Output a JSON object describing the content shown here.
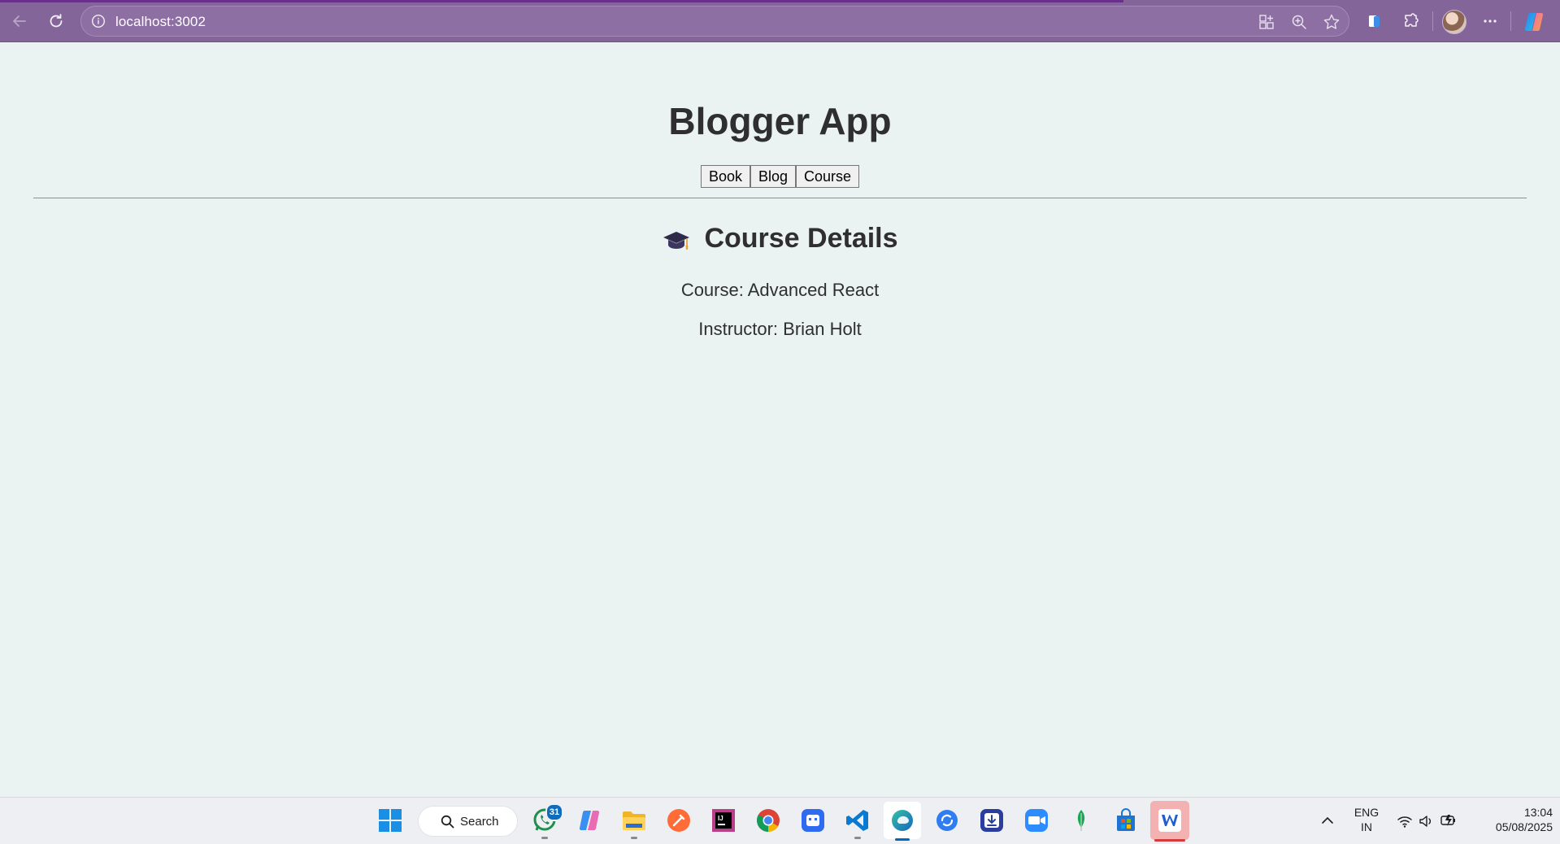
{
  "browser": {
    "url": "localhost:3002",
    "load_progress_percent": 72
  },
  "app": {
    "title": "Blogger App",
    "tabs": [
      {
        "label": "Book"
      },
      {
        "label": "Blog"
      },
      {
        "label": "Course"
      }
    ],
    "section": {
      "heading": "Course Details",
      "course_line": "Course: Advanced React",
      "instructor_line": "Instructor: Brian Holt"
    }
  },
  "taskbar": {
    "search_label": "Search",
    "whatsapp_badge": "31",
    "language": "ENG",
    "region": "IN",
    "time": "13:04",
    "date": "05/08/2025"
  },
  "colors": {
    "browser_frame": "#84659a",
    "page_background": "#ebf2f2",
    "text": "#2f2f2f"
  }
}
